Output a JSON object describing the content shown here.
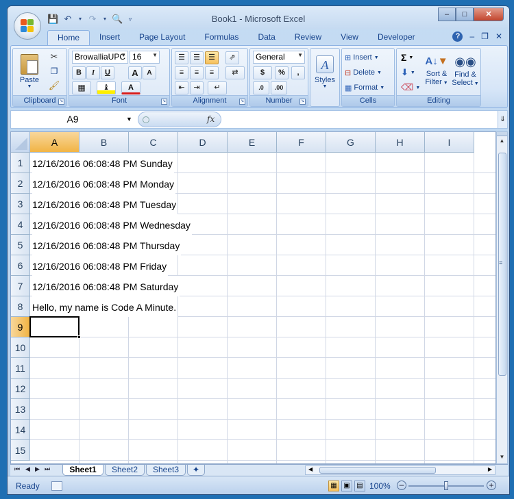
{
  "window": {
    "title": "Book1 - Microsoft Excel"
  },
  "qat": {
    "save_icon": "save-icon",
    "undo_icon": "undo-icon",
    "redo_icon": "redo-icon",
    "print_preview_icon": "print-preview-icon",
    "customize_icon": "customize-qat-icon"
  },
  "ribbon_tabs": [
    "Home",
    "Insert",
    "Page Layout",
    "Formulas",
    "Data",
    "Review",
    "View",
    "Developer"
  ],
  "active_tab": "Home",
  "ribbon": {
    "clipboard": {
      "label": "Clipboard",
      "paste": "Paste"
    },
    "font": {
      "label": "Font",
      "font_name": "BrowalliaUPC",
      "font_size": "16",
      "bold": "B",
      "italic": "I",
      "underline": "U",
      "grow": "A",
      "shrink": "A",
      "font_color": "A"
    },
    "alignment": {
      "label": "Alignment"
    },
    "number": {
      "label": "Number",
      "format": "General",
      "currency": "$",
      "percent": "%",
      "comma": ",",
      "inc_decimal": ".0",
      "dec_decimal": ".00"
    },
    "styles": {
      "label": "Styles"
    },
    "cells": {
      "label": "Cells",
      "insert": "Insert",
      "delete": "Delete",
      "format": "Format"
    },
    "editing": {
      "label": "Editing",
      "sort_filter_1": "Sort &",
      "sort_filter_2": "Filter",
      "find_select_1": "Find &",
      "find_select_2": "Select",
      "sum": "Σ"
    }
  },
  "formula_bar": {
    "name_box": "A9",
    "fx": "fx",
    "formula": ""
  },
  "columns": [
    "A",
    "B",
    "C",
    "D",
    "E",
    "F",
    "G",
    "H",
    "I"
  ],
  "selected_column": "A",
  "rows": [
    "1",
    "2",
    "3",
    "4",
    "5",
    "6",
    "7",
    "8",
    "9",
    "10",
    "11",
    "12",
    "13",
    "14",
    "15"
  ],
  "selected_row": "9",
  "cells": [
    {
      "row": 1,
      "text": "12/16/2016 06:08:48 PM Sunday"
    },
    {
      "row": 2,
      "text": "12/16/2016 06:08:48 PM Monday"
    },
    {
      "row": 3,
      "text": "12/16/2016 06:08:48 PM Tuesday"
    },
    {
      "row": 4,
      "text": "12/16/2016 06:08:48 PM Wednesday"
    },
    {
      "row": 5,
      "text": "12/16/2016 06:08:48 PM Thursday"
    },
    {
      "row": 6,
      "text": "12/16/2016 06:08:48 PM Friday"
    },
    {
      "row": 7,
      "text": "12/16/2016 06:08:48 PM Saturday"
    },
    {
      "row": 8,
      "text": "Hello, my name is Code A Minute."
    }
  ],
  "active_cell": "A9",
  "sheet_tabs": [
    "Sheet1",
    "Sheet2",
    "Sheet3"
  ],
  "active_sheet": "Sheet1",
  "status": {
    "ready": "Ready",
    "zoom": "100%"
  },
  "colors": {
    "selected_header": "#f1b444",
    "ribbon_text": "#15428b",
    "title_text": "#3b4c66"
  }
}
